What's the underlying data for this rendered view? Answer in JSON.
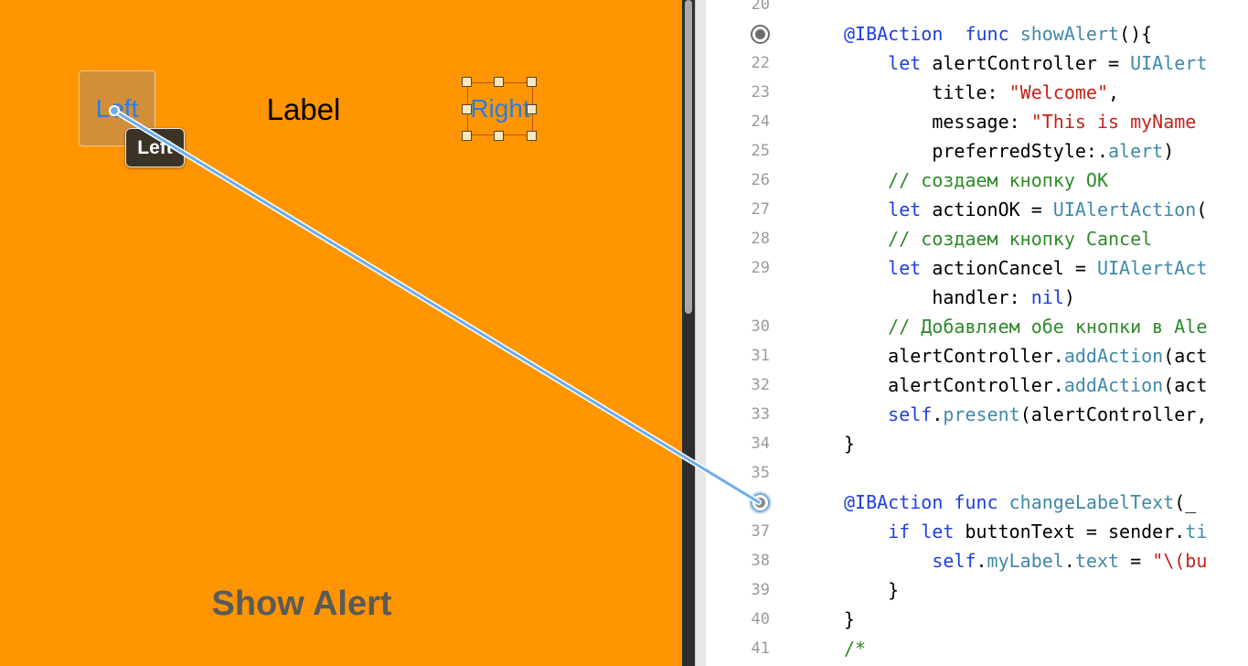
{
  "canvas": {
    "left_button": "Left",
    "center_label": "Label",
    "right_button": "Right",
    "show_alert_button": "Show Alert",
    "drag_tooltip": "Left"
  },
  "editor": {
    "lines": [
      {
        "no": "20",
        "marker": "none",
        "segs": []
      },
      {
        "no": "",
        "marker": "filled",
        "segs": [
          [
            "at",
            "@IBAction"
          ],
          [
            "",
            "  "
          ],
          [
            "kw",
            "func"
          ],
          [
            "",
            " "
          ],
          [
            "ty",
            "showAlert"
          ],
          [
            "",
            "(){"
          ]
        ]
      },
      {
        "no": "22",
        "marker": "none",
        "segs": [
          [
            "",
            "    "
          ],
          [
            "kw",
            "let"
          ],
          [
            "",
            " alertController = "
          ],
          [
            "ty",
            "UIAlert"
          ]
        ]
      },
      {
        "no": "23",
        "marker": "none",
        "segs": [
          [
            "",
            "        title: "
          ],
          [
            "str",
            "\"Welcome\""
          ],
          [
            "",
            ","
          ]
        ]
      },
      {
        "no": "24",
        "marker": "none",
        "segs": [
          [
            "",
            "        message: "
          ],
          [
            "str",
            "\"This is myName"
          ]
        ]
      },
      {
        "no": "25",
        "marker": "none",
        "segs": [
          [
            "",
            "        preferredStyle:."
          ],
          [
            "ty",
            "alert"
          ],
          [
            "",
            ")"
          ]
        ]
      },
      {
        "no": "26",
        "marker": "none",
        "segs": [
          [
            "",
            "    "
          ],
          [
            "cm",
            "// создаем кнопку OK"
          ]
        ]
      },
      {
        "no": "27",
        "marker": "none",
        "segs": [
          [
            "",
            "    "
          ],
          [
            "kw",
            "let"
          ],
          [
            "",
            " actionOK = "
          ],
          [
            "ty",
            "UIAlertAction"
          ],
          [
            "",
            "("
          ]
        ]
      },
      {
        "no": "28",
        "marker": "none",
        "segs": [
          [
            "",
            "    "
          ],
          [
            "cm",
            "// создаем кнопку Cancel"
          ]
        ]
      },
      {
        "no": "29",
        "marker": "none",
        "segs": [
          [
            "",
            "    "
          ],
          [
            "kw",
            "let"
          ],
          [
            "",
            " actionCancel = "
          ],
          [
            "ty",
            "UIAlertAct"
          ]
        ]
      },
      {
        "no": "",
        "marker": "none",
        "segs": [
          [
            "",
            "        handler: "
          ],
          [
            "kw",
            "nil"
          ],
          [
            "",
            ")"
          ]
        ]
      },
      {
        "no": "30",
        "marker": "none",
        "segs": [
          [
            "",
            "    "
          ],
          [
            "cm",
            "// Добавляем обе кнопки в Ale"
          ]
        ]
      },
      {
        "no": "31",
        "marker": "none",
        "segs": [
          [
            "",
            "    alertController."
          ],
          [
            "ty",
            "addAction"
          ],
          [
            "",
            "(act"
          ]
        ]
      },
      {
        "no": "32",
        "marker": "none",
        "segs": [
          [
            "",
            "    alertController."
          ],
          [
            "ty",
            "addAction"
          ],
          [
            "",
            "(act"
          ]
        ]
      },
      {
        "no": "33",
        "marker": "none",
        "segs": [
          [
            "",
            "    "
          ],
          [
            "kw",
            "self"
          ],
          [
            "",
            "."
          ],
          [
            "ty",
            "present"
          ],
          [
            "",
            "(alertController,"
          ]
        ]
      },
      {
        "no": "34",
        "marker": "none",
        "segs": [
          [
            "",
            "}"
          ]
        ]
      },
      {
        "no": "35",
        "marker": "none",
        "segs": []
      },
      {
        "no": "",
        "marker": "connecting",
        "segs": [
          [
            "at",
            "@IBAction"
          ],
          [
            "",
            " "
          ],
          [
            "kw",
            "func"
          ],
          [
            "",
            " "
          ],
          [
            "ty",
            "changeLabelText"
          ],
          [
            "",
            "(_ "
          ]
        ]
      },
      {
        "no": "37",
        "marker": "none",
        "segs": [
          [
            "",
            "    "
          ],
          [
            "kw",
            "if"
          ],
          [
            "",
            " "
          ],
          [
            "kw",
            "let"
          ],
          [
            "",
            " buttonText = sender."
          ],
          [
            "ty",
            "ti"
          ]
        ]
      },
      {
        "no": "38",
        "marker": "none",
        "segs": [
          [
            "",
            "        "
          ],
          [
            "kw",
            "self"
          ],
          [
            "",
            "."
          ],
          [
            "ty",
            "myLabel"
          ],
          [
            "",
            "."
          ],
          [
            "ty",
            "text"
          ],
          [
            "",
            " = "
          ],
          [
            "str",
            "\"\\(bu"
          ]
        ]
      },
      {
        "no": "39",
        "marker": "none",
        "segs": [
          [
            "",
            "    }"
          ]
        ]
      },
      {
        "no": "40",
        "marker": "none",
        "segs": [
          [
            "",
            "}"
          ]
        ]
      },
      {
        "no": "41",
        "marker": "none",
        "segs": [
          [
            "cm",
            "/*"
          ]
        ]
      }
    ]
  },
  "colors": {
    "canvas_background": "#ff9500",
    "connection_line": "#6aaef0",
    "keyword": "#1f3fe0",
    "type": "#3f89a8",
    "string": "#c4221b",
    "comment": "#2e8a2a"
  }
}
